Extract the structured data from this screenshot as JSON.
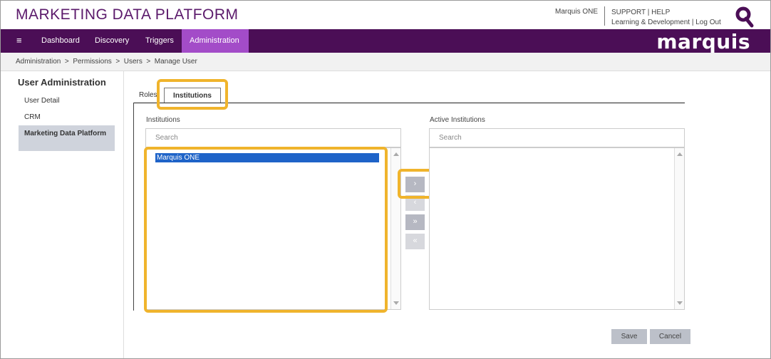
{
  "header": {
    "app_title": "MARKETING DATA PLATFORM",
    "user_name": "Marquis ONE",
    "support": "SUPPORT",
    "help": "HELP",
    "learning": "Learning & Development",
    "logout": "Log Out",
    "sep": "|",
    "brand": "marquis",
    "brand_icon": "magnifier-q-icon"
  },
  "nav": {
    "menu_icon": "≡",
    "items": [
      {
        "label": "Dashboard"
      },
      {
        "label": "Discovery"
      },
      {
        "label": "Triggers"
      },
      {
        "label": "Administration"
      }
    ],
    "active": "Administration",
    "bg_color": "#4b0e56",
    "active_color": "#a34cc8"
  },
  "breadcrumb": "Administration  >  Permissions  >  Users  >  Manage User",
  "sidebar": {
    "title": "User Administration",
    "items": [
      {
        "label": "User Detail"
      },
      {
        "label": "CRM"
      },
      {
        "label": "Marketing Data Platform"
      }
    ]
  },
  "tabs": {
    "roles": "Roles",
    "institutions": "Institutions"
  },
  "institutions": {
    "label": "Institutions",
    "search_placeholder": "Search",
    "options": [
      "Marquis ONE"
    ]
  },
  "active_institutions": {
    "label": "Active Institutions",
    "search_placeholder": "Search"
  },
  "move_buttons": {
    "add": "›",
    "remove": "‹",
    "add_all": "»",
    "remove_all": "«"
  },
  "footer": {
    "save": "Save",
    "cancel": "Cancel"
  },
  "highlight_color": "#f0b42c"
}
